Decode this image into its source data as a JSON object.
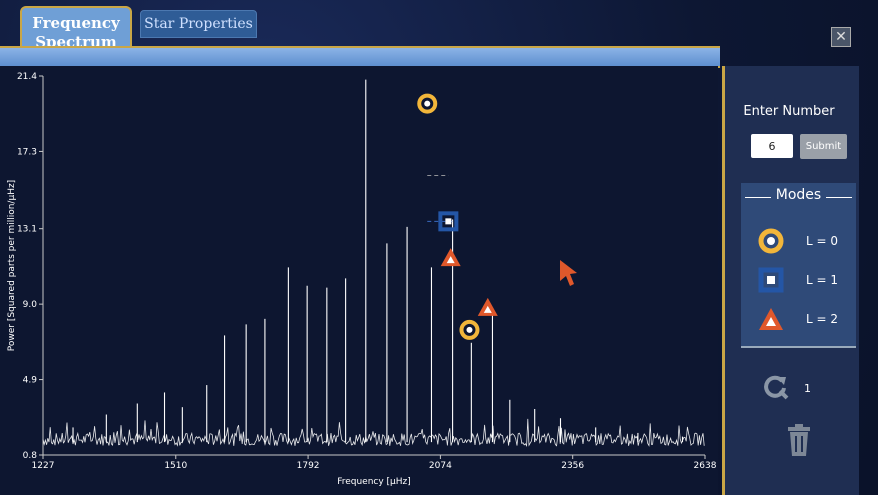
{
  "tabs": [
    {
      "label_line1": "Frequency",
      "label_line2": "Spectrum",
      "active": true
    },
    {
      "label": "Star Properties",
      "active": false
    }
  ],
  "close_label": "✕",
  "sidebar": {
    "enter_label": "Enter Number",
    "number_value": "6",
    "submit_label": "Submit",
    "modes_title": "Modes",
    "modes": [
      {
        "label": "L = 0",
        "icon": "circle-icon",
        "color": "#f2b63a"
      },
      {
        "label": "L = 1",
        "icon": "square-icon",
        "color": "#2456a6"
      },
      {
        "label": "L = 2",
        "icon": "triangle-icon",
        "color": "#e0582b"
      }
    ],
    "refresh_count": "1"
  },
  "chart_data": {
    "type": "line",
    "title": "",
    "xlabel": "Frequency [μHz]",
    "ylabel": "Power [Squared parts per million/μHz]",
    "xlim": [
      1227,
      2638
    ],
    "ylim": [
      0.8,
      21.4
    ],
    "x_ticks": [
      "1227",
      "1510",
      "1792",
      "2074",
      "2356",
      "2638"
    ],
    "y_ticks": [
      "0.8",
      "4.9",
      "9.0",
      "13.1",
      "17.3",
      "21.4"
    ],
    "grid": false,
    "peaks": [
      {
        "x": 1291,
        "y": 2.3
      },
      {
        "x": 1362,
        "y": 3.0
      },
      {
        "x": 1428,
        "y": 3.6
      },
      {
        "x": 1486,
        "y": 4.2
      },
      {
        "x": 1524,
        "y": 3.4
      },
      {
        "x": 1576,
        "y": 4.6
      },
      {
        "x": 1614,
        "y": 7.3
      },
      {
        "x": 1660,
        "y": 7.9
      },
      {
        "x": 1700,
        "y": 8.2
      },
      {
        "x": 1750,
        "y": 11.0
      },
      {
        "x": 1790,
        "y": 10.0
      },
      {
        "x": 1832,
        "y": 9.9
      },
      {
        "x": 1872,
        "y": 10.4
      },
      {
        "x": 1915,
        "y": 21.2
      },
      {
        "x": 1960,
        "y": 12.3
      },
      {
        "x": 2003,
        "y": 13.2
      },
      {
        "x": 2055,
        "y": 11.0
      },
      {
        "x": 2100,
        "y": 13.6
      },
      {
        "x": 2140,
        "y": 6.9
      },
      {
        "x": 2185,
        "y": 8.6
      },
      {
        "x": 2222,
        "y": 3.8
      },
      {
        "x": 2275,
        "y": 3.3
      },
      {
        "x": 2330,
        "y": 2.8
      },
      {
        "x": 2405,
        "y": 2.3
      },
      {
        "x": 2495,
        "y": 2.0
      },
      {
        "x": 2590,
        "y": 1.8
      }
    ],
    "markers": [
      {
        "mode": "L = 0",
        "x": 2046,
        "y": 19.9
      },
      {
        "mode": "L = 1",
        "x": 2091,
        "y": 13.5
      },
      {
        "mode": "L = 2",
        "x": 2096,
        "y": 11.5
      },
      {
        "mode": "L = 0",
        "x": 2136,
        "y": 7.6
      },
      {
        "mode": "L = 2",
        "x": 2175,
        "y": 8.8
      }
    ],
    "line_color": "#ffffff",
    "background": "#0d1630"
  },
  "colors": {
    "gold": "#c9a646",
    "panel": "#1f2e52",
    "accent": "#e0582b"
  }
}
